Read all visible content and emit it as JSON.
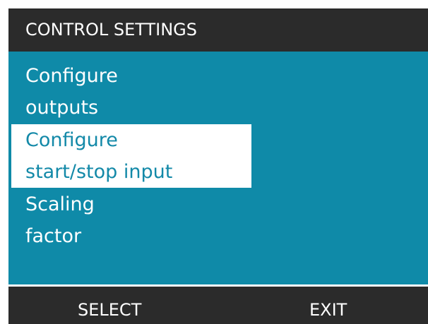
{
  "header": {
    "title": "CONTROL SETTINGS"
  },
  "menu": {
    "items": [
      {
        "line1": "Configure",
        "line2": "outputs",
        "selected": false
      },
      {
        "line1": "Configure",
        "line2": "start/stop input",
        "selected": true
      },
      {
        "line1": "Scaling",
        "line2": "factor",
        "selected": false
      }
    ]
  },
  "softkeys": {
    "left": "SELECT",
    "right": "EXIT"
  },
  "colors": {
    "background_frame": "#2b2b2b",
    "menu_background": "#0f8aa8",
    "selected_background": "#ffffff",
    "selected_text": "#1389a8",
    "text": "#ffffff"
  }
}
